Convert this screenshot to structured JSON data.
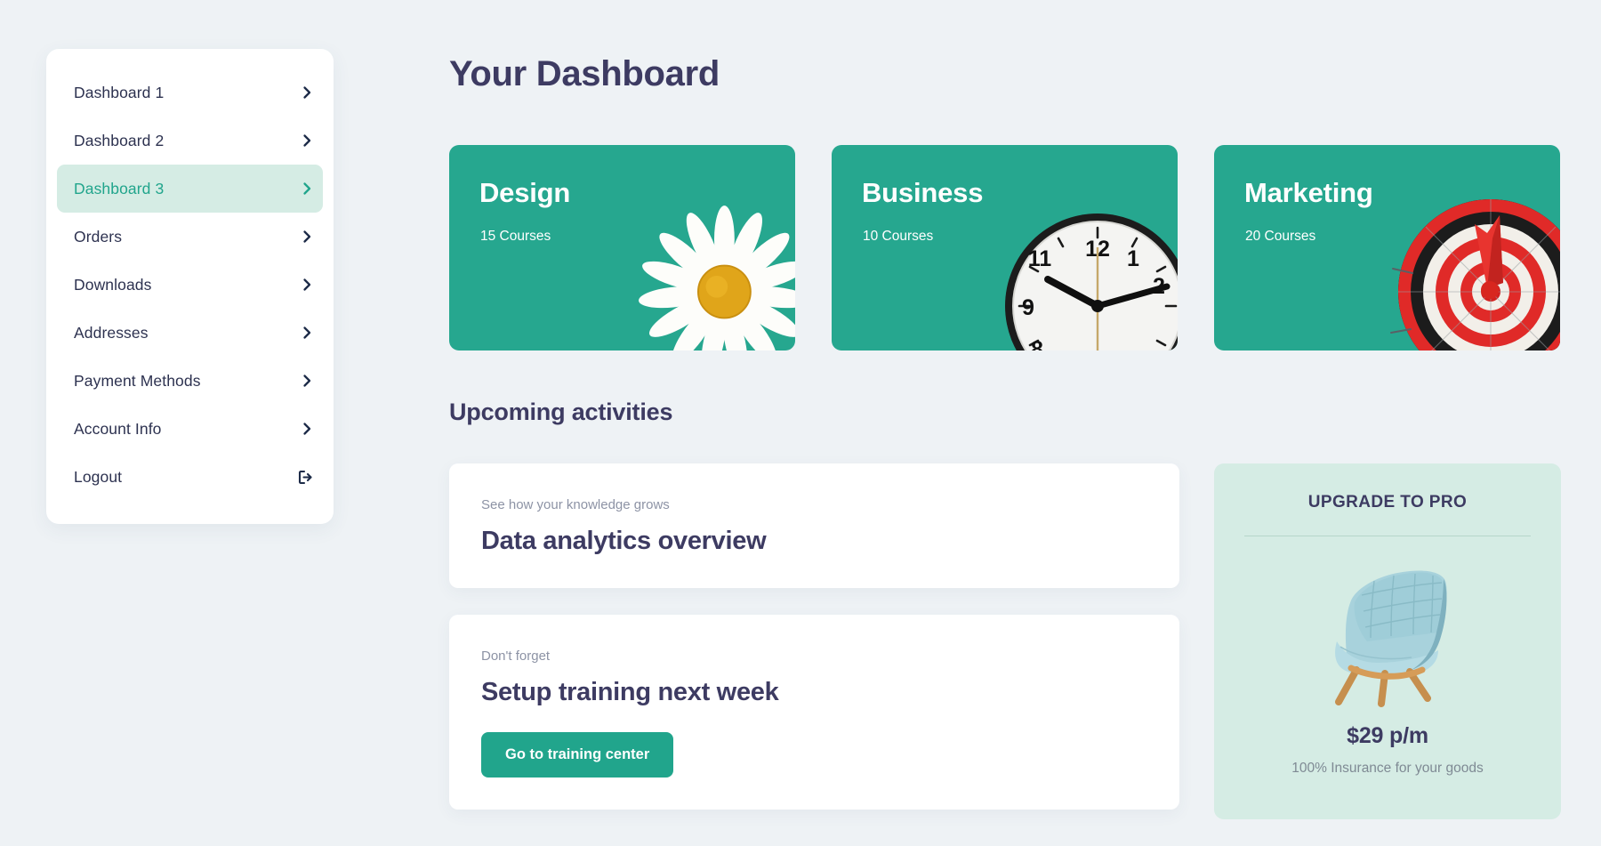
{
  "sidebar": {
    "items": [
      {
        "label": "Dashboard 1",
        "icon": "chevron-right-icon",
        "active": false
      },
      {
        "label": "Dashboard 2",
        "icon": "chevron-right-icon",
        "active": false
      },
      {
        "label": "Dashboard 3",
        "icon": "chevron-right-icon",
        "active": true
      },
      {
        "label": "Orders",
        "icon": "chevron-right-icon",
        "active": false
      },
      {
        "label": "Downloads",
        "icon": "chevron-right-icon",
        "active": false
      },
      {
        "label": "Addresses",
        "icon": "chevron-right-icon",
        "active": false
      },
      {
        "label": "Payment Methods",
        "icon": "chevron-right-icon",
        "active": false
      },
      {
        "label": "Account Info",
        "icon": "chevron-right-icon",
        "active": false
      },
      {
        "label": "Logout",
        "icon": "logout-icon",
        "active": false
      }
    ]
  },
  "header": {
    "title": "Your Dashboard"
  },
  "courses": {
    "cards": [
      {
        "title": "Design",
        "count": "15 Courses",
        "art": "daisy-flower-image"
      },
      {
        "title": "Business",
        "count": "10 Courses",
        "art": "wall-clock-image"
      },
      {
        "title": "Marketing",
        "count": "20 Courses",
        "art": "dartboard-target-image"
      }
    ]
  },
  "activities": {
    "section_title": "Upcoming activities",
    "cards": [
      {
        "kicker": "See how your knowledge grows",
        "heading": "Data analytics overview",
        "button": null
      },
      {
        "kicker": "Don't forget",
        "heading": "Setup training next week",
        "button": "Go to training center"
      }
    ]
  },
  "upgrade": {
    "title": "UPGRADE TO PRO",
    "art": "blue-lounge-chair-image",
    "price": "$29 p/m",
    "note": "100% Insurance for your goods"
  },
  "colors": {
    "background": "#eef2f5",
    "teal": "#26a78f",
    "teal_button": "#21a58c",
    "mint": "#d5ece4",
    "navy_text": "#3d3b62",
    "muted_text": "#8d93a5"
  }
}
